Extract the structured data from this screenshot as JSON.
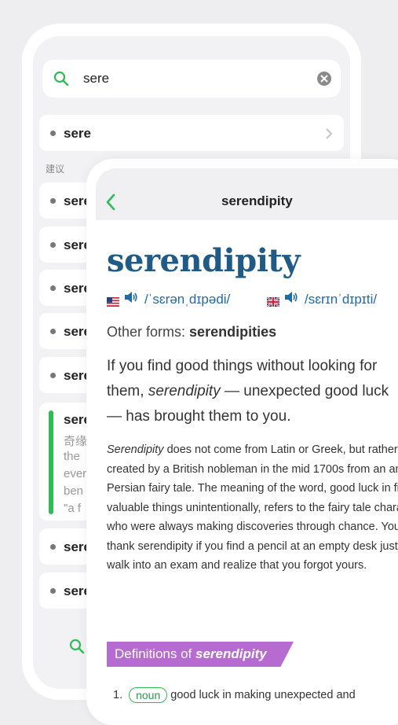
{
  "search": {
    "query": "sere"
  },
  "list": {
    "top_item": "sere",
    "section_label": "建议",
    "items": [
      "sere",
      "sere",
      "sere",
      "sere",
      "sere"
    ],
    "highlight": {
      "word": "sere",
      "lines": [
        "奇缘",
        "the",
        "ever",
        "ben",
        "\"a f"
      ]
    },
    "items_after": [
      "sere",
      "sere"
    ]
  },
  "entry": {
    "header_title": "serendipity",
    "headword": "serendipity",
    "pron_us": "/ˈsɛrənˌdɪpədi/",
    "pron_uk": "/sɛrɪnˈdɪpɪti/",
    "other_forms_label": "Other forms:",
    "other_forms_value": "serendipities",
    "lead_1": "If you find good things without looking for them,",
    "lead_italic": "serendipity",
    "lead_2": "— unexpected good luck — has brought them to you.",
    "body_italic": "Serendipity",
    "body_rest": " does not come from Latin or Greek, but rather was created by a British nobleman in the mid 1700s from an ancient Persian fairy tale. The meaning of the word, good luck in finding valuable things unintentionally, refers to the fairy tale characters who were always making discoveries through chance. You can thank serendipity if you find a pencil at an empty desk just as you walk into an exam and realize that you forgot yours.",
    "definitions_label": "Definitions of",
    "definitions_word": "serendipity",
    "def_number": "1.",
    "def_pos": "noun",
    "def_text": "good luck in making unexpected and"
  },
  "colors": {
    "accent_green": "#2fbb55",
    "headword_blue": "#1f5b86",
    "banner_purple": "#b56bd0"
  },
  "icons": [
    "search-icon",
    "clear-icon",
    "chevron-right-icon",
    "back-arrow-icon",
    "us-flag-icon",
    "uk-flag-icon",
    "speaker-icon"
  ]
}
